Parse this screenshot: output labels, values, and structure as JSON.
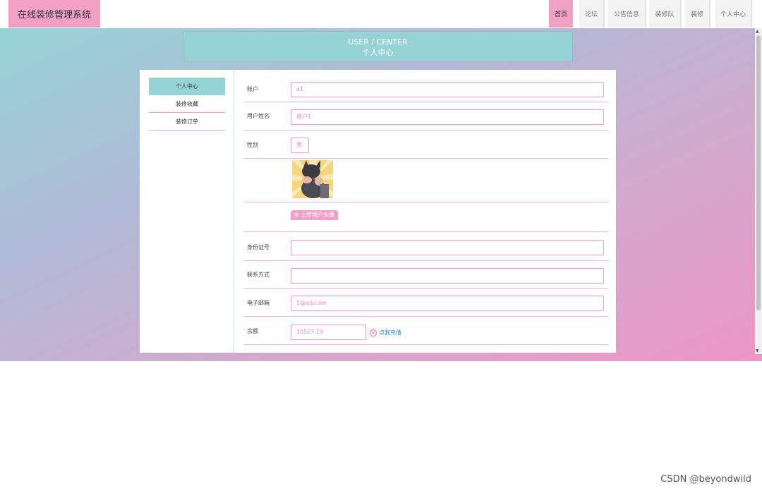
{
  "app": {
    "title": "在线装修管理系统"
  },
  "nav": [
    {
      "label": "首页",
      "active": true
    },
    {
      "label": "论坛",
      "active": false
    },
    {
      "label": "公告信息",
      "active": false
    },
    {
      "label": "装修队",
      "active": false
    },
    {
      "label": "装修",
      "active": false
    },
    {
      "label": "个人中心",
      "active": false
    }
  ],
  "page_header": {
    "en": "USER / CENTER",
    "zh": "个人中心"
  },
  "sidebar": {
    "items": [
      {
        "label": "个人中心",
        "active": true
      },
      {
        "label": "装修收藏",
        "active": false
      },
      {
        "label": "装修订单",
        "active": false
      }
    ]
  },
  "form": {
    "account_label": "账户",
    "account_value": "a1",
    "username_label": "用户姓名",
    "username_value": "用户1",
    "gender_label": "性别",
    "gender_value": "男",
    "upload_label": "上传用户头像",
    "idcard_label": "身份证号",
    "idcard_value": "",
    "phone_label": "联系方式",
    "phone_value": "",
    "email_label": "电子邮箱",
    "email_value": "1@qq.com",
    "balance_label": "余额",
    "balance_value": "10507.19",
    "recharge_label": "点我充值"
  },
  "colors": {
    "accent_pink": "#f0a1c4",
    "accent_teal": "#96d3d6",
    "link_blue": "#2b83c7"
  },
  "watermark": "CSDN @beyondwild"
}
